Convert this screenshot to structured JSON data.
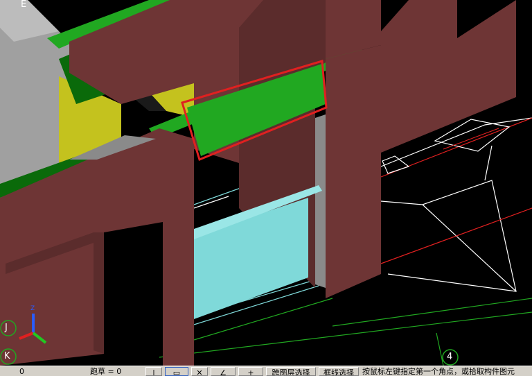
{
  "viewport": {
    "grid_labels": {
      "top_left": "E",
      "left_mid": "J",
      "left_bottom": "K",
      "bottom_right": "4"
    },
    "axis_triad": {
      "x": "X",
      "y": "Y",
      "z": "Z"
    },
    "colors": {
      "wall": "#6e3535",
      "slab": "#21a821",
      "column": "#c4c21e",
      "window": "#7fd9d9",
      "selection": "#e02020",
      "background": "#000000"
    }
  },
  "statusbar": {
    "coord_text": "0",
    "elevation_label": "跑草 = 0",
    "tool_icons": [
      "line-tool-icon",
      "select-box-icon",
      "cross-icon",
      "angle-icon",
      "plus-icon"
    ],
    "btn_layer_select": "跨图层选择",
    "btn_break_select": "框线选择",
    "prompt": "按鼠标左键指定第一个角点，或拾取构件图元"
  }
}
